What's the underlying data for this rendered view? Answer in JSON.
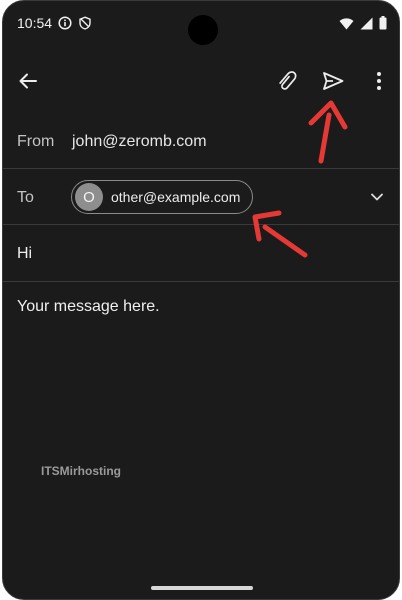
{
  "status_bar": {
    "time": "10:54",
    "left_icons": [
      "info-icon",
      "shield-icon"
    ],
    "right_icons": [
      "wifi-icon",
      "signal-icon",
      "battery-icon"
    ]
  },
  "toolbar": {
    "back_icon": "arrow-left-icon",
    "attach_icon": "paperclip-icon",
    "send_icon": "send-icon",
    "more_icon": "more-vert-icon"
  },
  "compose": {
    "from_label": "From",
    "from_value": "john@zeromb.com",
    "to_label": "To",
    "to_chip": {
      "avatar_letter": "O",
      "email": "other@example.com"
    },
    "subject": "Hi",
    "body": "Your message here."
  },
  "watermark": "ITSMirhosting",
  "colors": {
    "background": "#1b1b1b",
    "annotation_arrow": "#e53935",
    "divider": "#3a3a3a"
  }
}
